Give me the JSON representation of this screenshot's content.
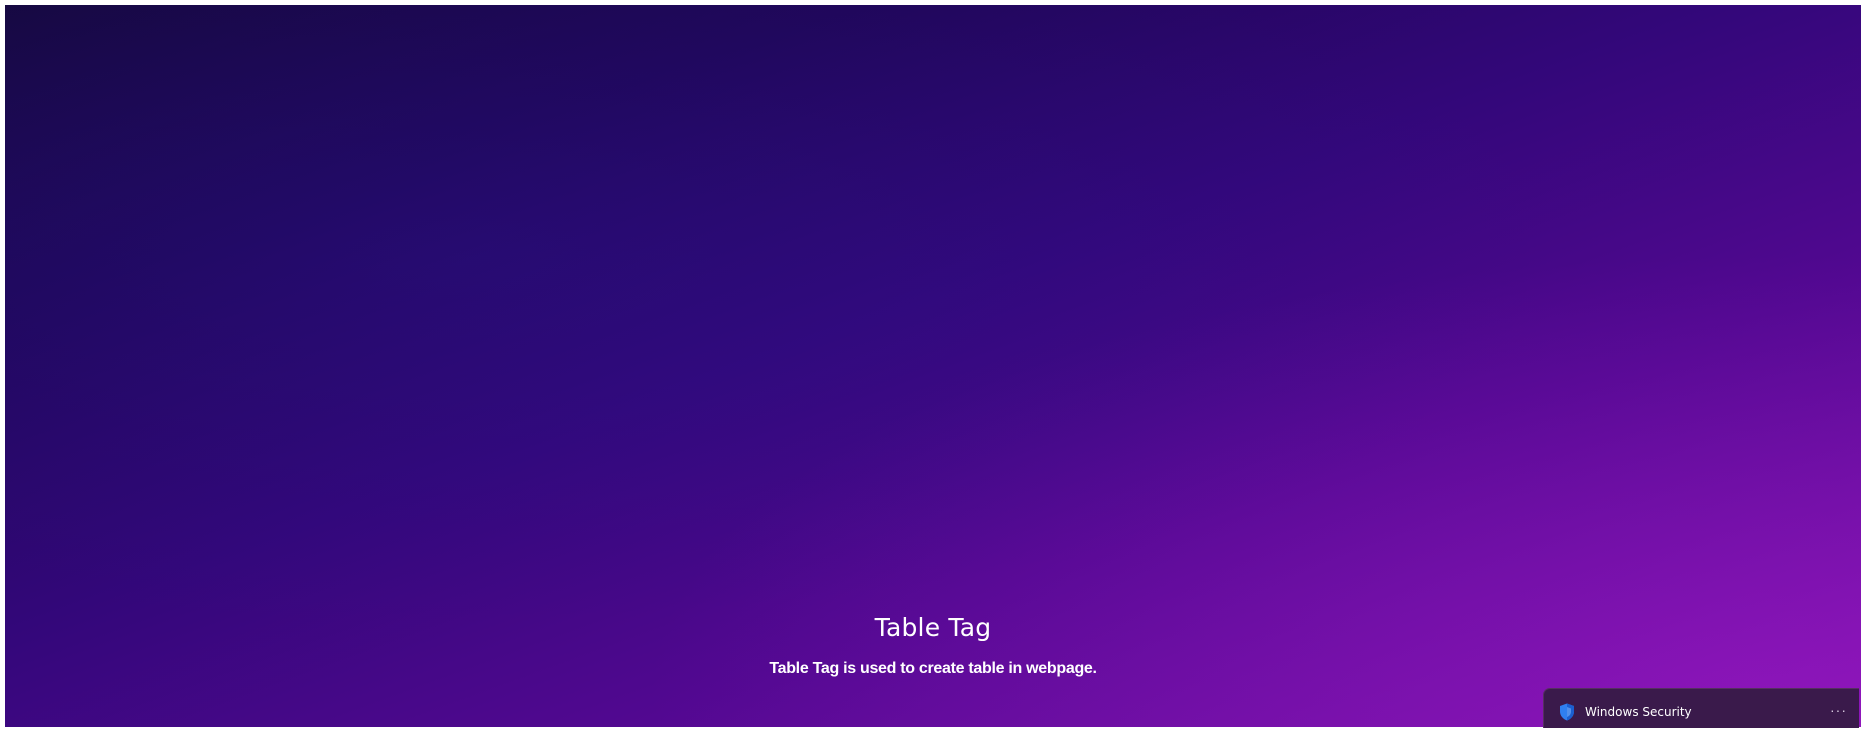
{
  "hero": {
    "title": "Table Tag",
    "description": "Table Tag is used to create table in webpage."
  },
  "notification": {
    "app_name": "Windows Security",
    "more_label": "···"
  },
  "colors": {
    "background_top_left": "#15083d",
    "background_bottom_right": "#8212b0",
    "shield_blue": "#2f7ff0",
    "toast_background": "#3a1a4b"
  }
}
